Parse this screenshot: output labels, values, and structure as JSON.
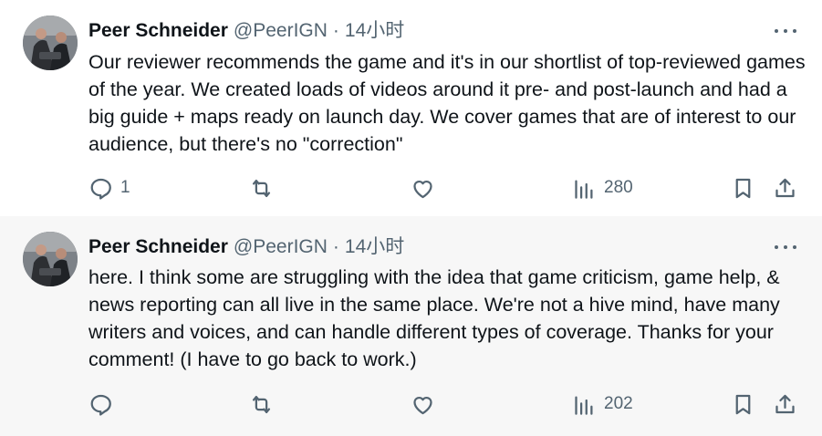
{
  "tweets": [
    {
      "author_name": "Peer Schneider",
      "handle": "@PeerIGN",
      "separator": "·",
      "time": "14小时",
      "text": "Our reviewer recommends the game and it's in our shortlist of top-reviewed games of the year. We created loads of videos around it pre- and post-launch and had a big guide + maps ready on launch day. We cover games that are of interest to our audience, but there's no \"correction\"",
      "reply_count": "1",
      "views_count": "280"
    },
    {
      "author_name": "Peer Schneider",
      "handle": "@PeerIGN",
      "separator": "·",
      "time": "14小时",
      "text": "here. I think some are struggling with the idea that game criticism, game help, & news reporting can all live in the same place. We're not a hive mind, have many writers and voices, and can handle different types of coverage. Thanks for your comment! (I have to go back to work.)",
      "reply_count": "",
      "views_count": "202"
    }
  ],
  "colors": {
    "text_primary": "#0f1419",
    "text_secondary": "#536471",
    "thread_line": "#cfd9de",
    "highlight_bg": "#f7f7f7"
  },
  "icons": [
    "reply-icon",
    "retweet-icon",
    "like-icon",
    "views-icon",
    "bookmark-icon",
    "share-icon",
    "more-icon"
  ]
}
